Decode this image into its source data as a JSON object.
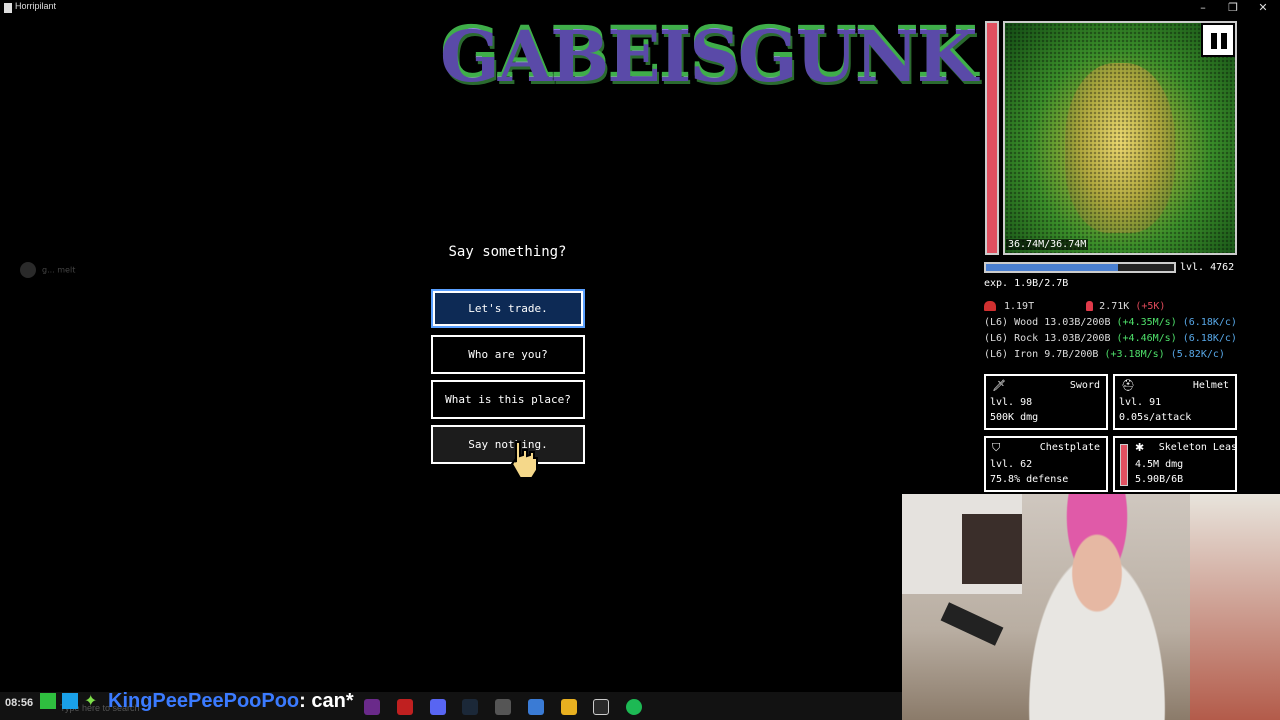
{
  "window": {
    "title": "Horripilant",
    "minimize": "–",
    "maximize": "❐",
    "close": "✕"
  },
  "logo": {
    "text": "GABEISGUNK"
  },
  "dialog": {
    "question": "Say something?",
    "options": [
      "Let's trade.",
      "Who are you?",
      "What is this place?",
      "Say nothing."
    ],
    "selected_index": 0,
    "hover_index": 3
  },
  "chat_ghost": {
    "text": "g... melt"
  },
  "player": {
    "hp": "36.74M/36.74M",
    "level": "lvl. 4762",
    "exp": "exp. 1.9B/2.7B",
    "exp_fraction": 0.7
  },
  "resources": {
    "hearts": "1.19T",
    "skulls": "2.71K",
    "skulls_gain": "(+5K)",
    "rows": [
      {
        "level": "(L6)",
        "name": "Wood",
        "amount": "13.03B/200B",
        "rate": "(+4.35M/s)",
        "click": "(6.18K/c)"
      },
      {
        "level": "(L6)",
        "name": "Rock",
        "amount": "13.03B/200B",
        "rate": "(+4.46M/s)",
        "click": "(6.18K/c)"
      },
      {
        "level": "(L6)",
        "name": "Iron",
        "amount": "9.7B/200B",
        "rate": "(+3.18M/s)",
        "click": "(5.82K/c)"
      }
    ]
  },
  "gear": {
    "sword": {
      "name": "Sword",
      "level": "lvl. 98",
      "stat": "500K dmg",
      "icon": "sword-icon"
    },
    "helmet": {
      "name": "Helmet",
      "level": "lvl. 91",
      "stat": "0.05s/attack",
      "icon": "helmet-icon"
    },
    "chestplate": {
      "name": "Chestplate",
      "level": "lvl. 62",
      "stat": "75.8% defense",
      "icon": "chestplate-icon"
    },
    "leash": {
      "name": "Skeleton Leas",
      "level": "4.5M dmg",
      "stat": "5.90B/6B",
      "icon": "skeleton-icon"
    }
  },
  "taskbar": {
    "time": "08:56",
    "search_hint": "Type here to search"
  },
  "chat": {
    "user": "KingPeePeePooPoo",
    "message": ": can*"
  },
  "colors": {
    "accent_blue": "#4a7fd0",
    "hp_red": "#e05060",
    "rate_green": "#4ee06a",
    "click_blue": "#58a8e8"
  }
}
